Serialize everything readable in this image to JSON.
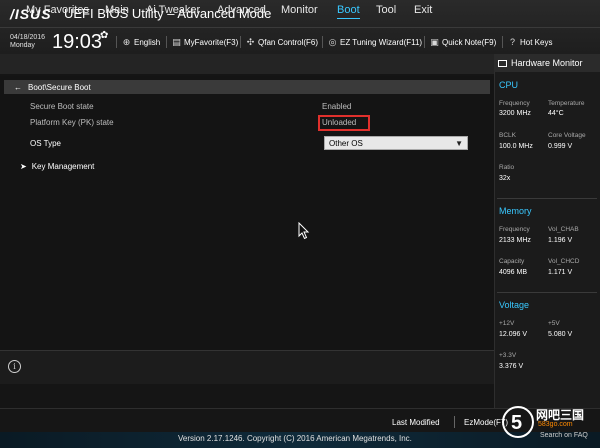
{
  "header": {
    "logo": "/ISUS",
    "title": "UEFI BIOS Utility – Advanced Mode",
    "date": "04/18/2016",
    "day": "Monday",
    "time": "19:03",
    "tools": [
      {
        "label": "English",
        "icon": "globe-icon"
      },
      {
        "label": "MyFavorite(F3)",
        "icon": "favorite-icon"
      },
      {
        "label": "Qfan Control(F6)",
        "icon": "fan-icon"
      },
      {
        "label": "EZ Tuning Wizard(F11)",
        "icon": "wizard-icon"
      },
      {
        "label": "Quick Note(F9)",
        "icon": "note-icon"
      },
      {
        "label": "Hot Keys",
        "icon": "question-icon"
      }
    ]
  },
  "nav": {
    "tabs": [
      "My Favorites",
      "Main",
      "Ai Tweaker",
      "Advanced",
      "Monitor",
      "Boot",
      "Tool",
      "Exit"
    ],
    "active": "Boot"
  },
  "main": {
    "breadcrumb": "Boot\\Secure Boot",
    "rows": [
      {
        "label": "Secure Boot state",
        "value": "Enabled"
      },
      {
        "label": "Platform Key (PK) state",
        "value": "Unloaded"
      }
    ],
    "os_type": {
      "label": "OS Type",
      "selected": "Other OS"
    },
    "key_management": "Key Management"
  },
  "bottom": {
    "last_modified": "Last Modified",
    "ez_mode": "EzMode(F7)",
    "version": "Version 2.17.1246. Copyright (C) 2016 American Megatrends, Inc.",
    "faq": "Search on FAQ",
    "watermark": "网吧三国",
    "watermark_sub": "583go.com"
  },
  "hardware_monitor": {
    "title": "Hardware Monitor",
    "cpu": {
      "heading": "CPU",
      "items": [
        {
          "label": "Frequency",
          "value": "3200 MHz"
        },
        {
          "label": "Temperature",
          "value": "44°C"
        },
        {
          "label": "BCLK",
          "value": "100.0 MHz"
        },
        {
          "label": "Core Voltage",
          "value": "0.999 V"
        },
        {
          "label": "Ratio",
          "value": "32x"
        }
      ]
    },
    "memory": {
      "heading": "Memory",
      "items": [
        {
          "label": "Frequency",
          "value": "2133 MHz"
        },
        {
          "label": "Vol_CHAB",
          "value": "1.196 V"
        },
        {
          "label": "Capacity",
          "value": "4096 MB"
        },
        {
          "label": "Vol_CHCD",
          "value": "1.171 V"
        }
      ]
    },
    "voltage": {
      "heading": "Voltage",
      "items": [
        {
          "label": "+12V",
          "value": "12.096 V"
        },
        {
          "label": "+5V",
          "value": "5.080 V"
        },
        {
          "label": "+3.3V",
          "value": "3.376 V"
        }
      ]
    }
  },
  "colors": {
    "accent": "#39c8ff",
    "highlight_box": "#e0302c"
  }
}
